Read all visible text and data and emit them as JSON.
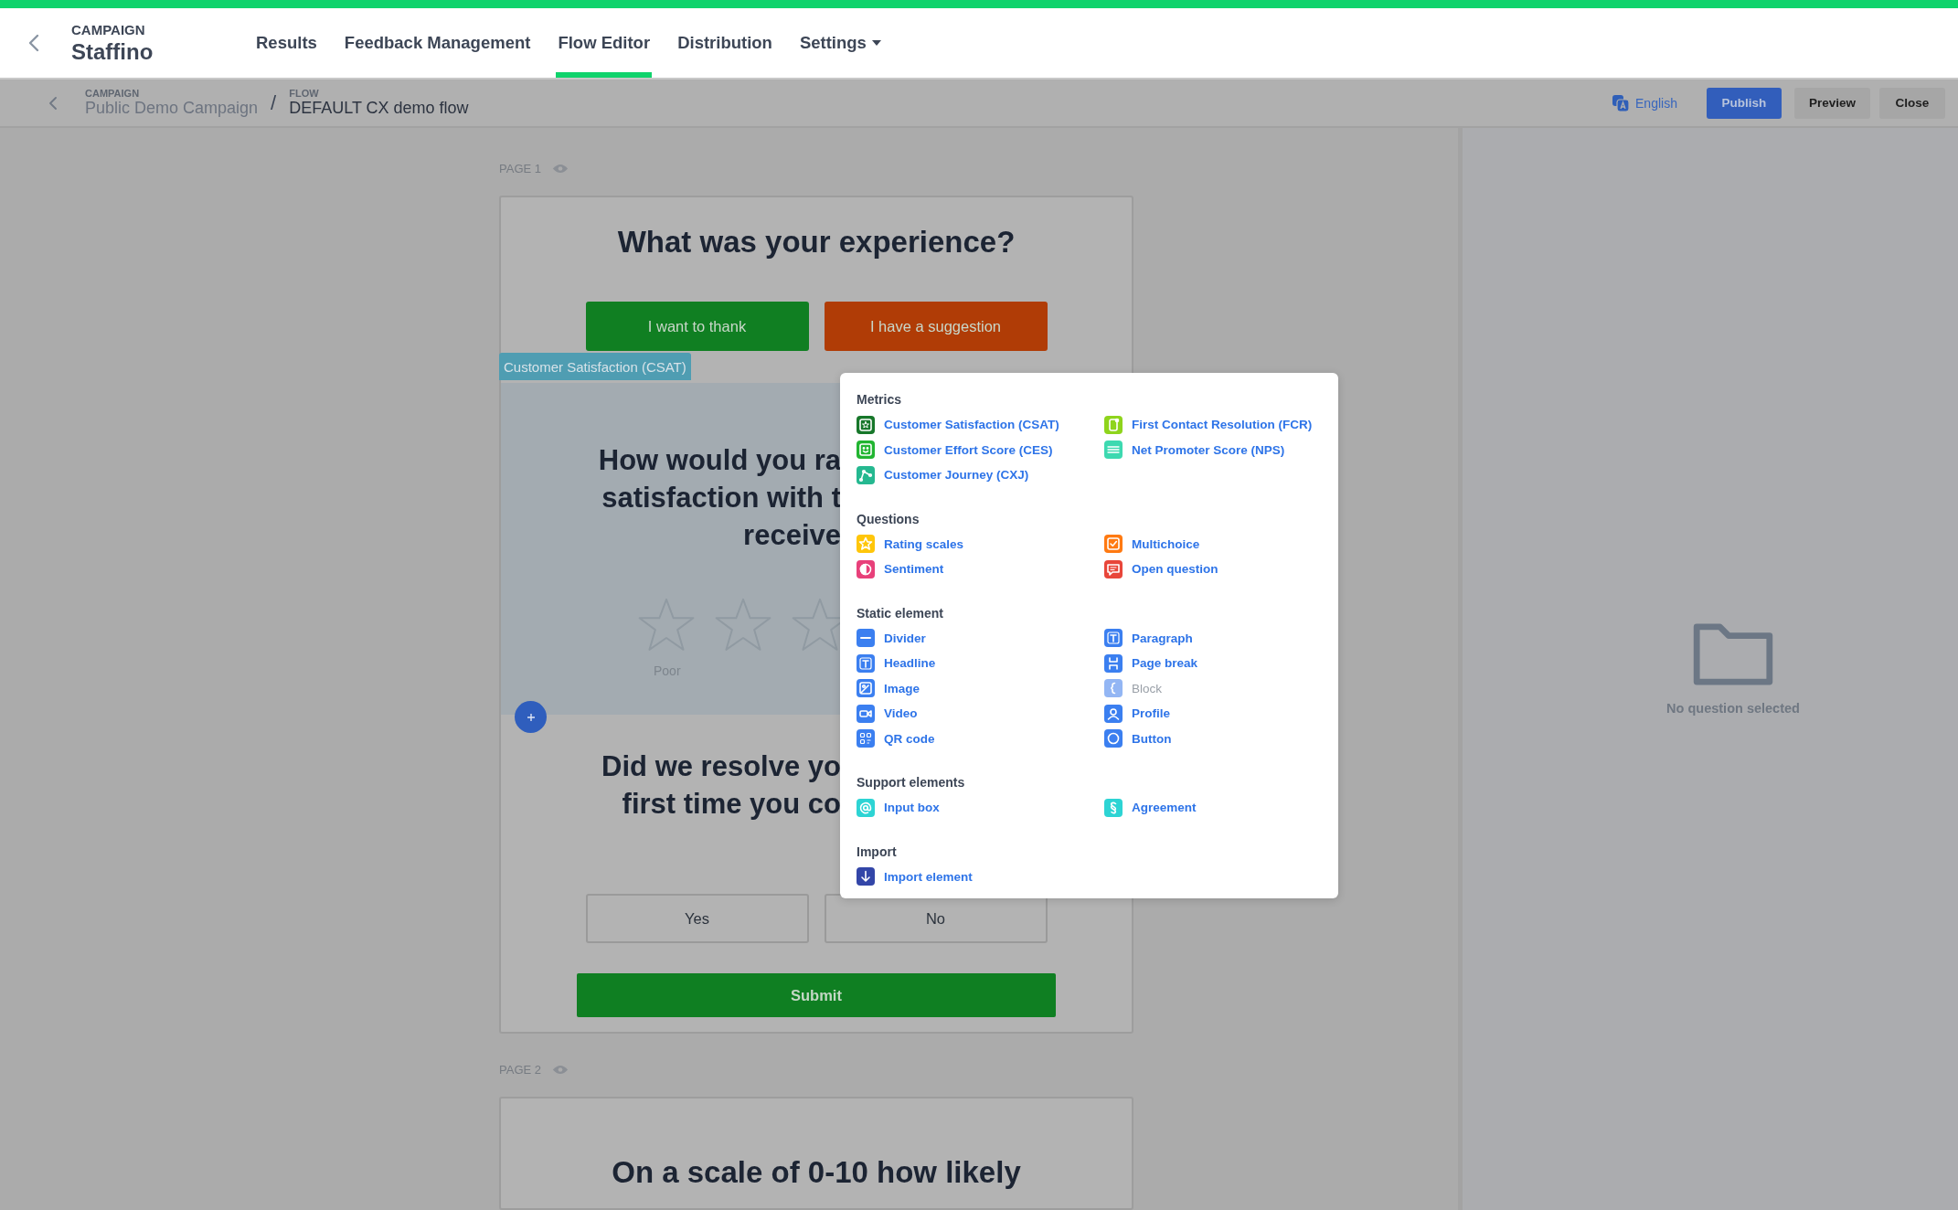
{
  "header": {
    "campaign_label": "CAMPAIGN",
    "campaign_name": "Staffino",
    "tabs": [
      {
        "label": "Results",
        "selected": false,
        "dropdown": false
      },
      {
        "label": "Feedback Management",
        "selected": false,
        "dropdown": false
      },
      {
        "label": "Flow Editor",
        "selected": true,
        "dropdown": false
      },
      {
        "label": "Distribution",
        "selected": false,
        "dropdown": false
      },
      {
        "label": "Settings",
        "selected": false,
        "dropdown": true
      }
    ]
  },
  "subheader": {
    "breadcrumb": [
      {
        "label": "CAMPAIGN",
        "value": "Public Demo Campaign"
      },
      {
        "label": "FLOW",
        "value": "DEFAULT CX demo flow"
      }
    ],
    "separator": "/",
    "language": "English",
    "actions": [
      {
        "label": "Publish",
        "kind": "primary"
      },
      {
        "label": "Preview",
        "kind": "secondary"
      },
      {
        "label": "Close",
        "kind": "secondary"
      }
    ]
  },
  "pages": [
    {
      "label": "PAGE 1",
      "elements": [
        {
          "kind": "heading",
          "text": "What was your experience?"
        },
        {
          "kind": "choice_buttons",
          "buttons": [
            {
              "label": "I want to thank",
              "color": "#107f22"
            },
            {
              "label": "I have a suggestion",
              "color": "#b03c06"
            }
          ]
        },
        {
          "kind": "metric_block",
          "selected": true,
          "tag": "Customer Satisfaction (CSAT)",
          "lines": [
            "How would you ra",
            "satisfaction with t",
            "receive"
          ],
          "min_label": "Poor"
        },
        {
          "kind": "question",
          "lines": [
            "Did we resolve yo",
            "first time you co"
          ],
          "buttons": [
            "Yes",
            "No"
          ]
        },
        {
          "kind": "submit",
          "label": "Submit"
        }
      ]
    },
    {
      "label": "PAGE 2",
      "elements": [
        {
          "kind": "heading",
          "text": "On a scale of 0-10 how likely"
        }
      ]
    }
  ],
  "add_menu": {
    "sections": [
      {
        "title": "Metrics",
        "items": [
          {
            "label": "Customer Satisfaction (CSAT)",
            "kind": "csat",
            "color": "#17772a",
            "disabled": false
          },
          {
            "label": "First Contact Resolution (FCR)",
            "kind": "fcr",
            "color": "#8fd41c",
            "disabled": false
          },
          {
            "label": "Customer Effort Score (CES)",
            "kind": "ces",
            "color": "#22b531",
            "disabled": false
          },
          {
            "label": "Net Promoter Score (NPS)",
            "kind": "nps",
            "color": "#3dd9b0",
            "disabled": false
          },
          {
            "label": "Customer Journey (CXJ)",
            "kind": "cxj",
            "color": "#25b890",
            "disabled": false
          }
        ]
      },
      {
        "title": "Questions",
        "items": [
          {
            "label": "Rating scales",
            "kind": "rating",
            "color": "#ffc60a",
            "disabled": false
          },
          {
            "label": "Multichoice",
            "kind": "multichoice",
            "color": "#ff7a12",
            "disabled": false
          },
          {
            "label": "Sentiment",
            "kind": "sentiment",
            "color": "#e8407a",
            "disabled": false
          },
          {
            "label": "Open question",
            "kind": "open",
            "color": "#e8463a",
            "disabled": false
          }
        ]
      },
      {
        "title": "Static element",
        "items": [
          {
            "label": "Divider",
            "kind": "divider",
            "color": "#3b7ff0",
            "disabled": false
          },
          {
            "label": "Paragraph",
            "kind": "paragraph",
            "color": "#3b7ff0",
            "disabled": false
          },
          {
            "label": "Headline",
            "kind": "headline",
            "color": "#3b7ff0",
            "disabled": false
          },
          {
            "label": "Page break",
            "kind": "pagebreak",
            "color": "#3b7ff0",
            "disabled": false
          },
          {
            "label": "Image",
            "kind": "image",
            "color": "#3b7ff0",
            "disabled": false
          },
          {
            "label": "Block",
            "kind": "block",
            "color": "#93b6f4",
            "disabled": true
          },
          {
            "label": "Video",
            "kind": "video",
            "color": "#3b7ff0",
            "disabled": false
          },
          {
            "label": "Profile",
            "kind": "profile",
            "color": "#3b7ff0",
            "disabled": false
          },
          {
            "label": "QR code",
            "kind": "qr",
            "color": "#3b7ff0",
            "disabled": false
          },
          {
            "label": "Button",
            "kind": "button",
            "color": "#3b7ff0",
            "disabled": false
          }
        ]
      },
      {
        "title": "Support elements",
        "items": [
          {
            "label": "Input box",
            "kind": "input",
            "color": "#2dd4d4",
            "disabled": false
          },
          {
            "label": "Agreement",
            "kind": "agreement",
            "color": "#2dd4d4",
            "disabled": false
          }
        ]
      },
      {
        "title": "Import",
        "items": [
          {
            "label": "Import element",
            "kind": "import",
            "color": "#3346a8",
            "disabled": false
          }
        ]
      }
    ]
  },
  "side_panel": {
    "empty_text": "No question selected"
  }
}
